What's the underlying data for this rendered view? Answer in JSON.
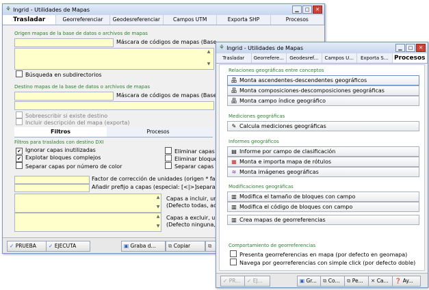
{
  "back": {
    "title": "Ingrid - Utilidades de Mapas",
    "tabs": [
      "Trasladar",
      "Georreferenciar",
      "Geodesreferenciar",
      "Campos UTM",
      "Exporta SHP",
      "Procesos"
    ],
    "origen_header": "Origen mapas de la base de datos o archivos de mapas",
    "mascara_label_1": "Máscara de códigos de mapas (Base",
    "busqueda": "Búsqueda en subdirectorios",
    "destino_header": "Destino mapas de la base de datos o archivos de mapas",
    "mascara_label_2": "Máscara de códigos de mapas (Base",
    "sobrescribir": "Sobreescribir si existe destino",
    "incluir": "Incluir descripción del mapa (exporta)",
    "subtabs": [
      "Filtros",
      "Procesos"
    ],
    "filtros_header": "Filtros para traslados con destino DXI",
    "ignorar": "Ignorar capas inutilizadas",
    "explotar": "Explotar bloques complejos",
    "separar": "Separar capas por número de color",
    "eliminar1": "Eliminar capas n",
    "eliminar2": "Eliminar bloque",
    "separar2": "Separar capas p",
    "factor": "Factor de corrección de unidades (origen * fa",
    "prefijo": "Añadir prefijo a capas (especial: [<|>]separa",
    "capas_incluir": "Capas a incluir, un",
    "capas_incluir_sub": "(Defecto todas, ad",
    "capas_excluir": "Capas a excluir, u",
    "capas_excluir_sub": "(Defecto ninguna,",
    "btn_prueba": "PRUEBA",
    "btn_ejecuta": "EJECUTA",
    "btn_graba": "Graba d...",
    "btn_copiar": "Copiar"
  },
  "front": {
    "title": "Ingrid - Utilidades de Mapas",
    "tabs": [
      "Trasladar",
      "Georrefere...",
      "Geodesref...",
      "Campos U...",
      "Exporta S...",
      "Procesos"
    ],
    "relaciones_header": "Relaciones geográficas entre conceptos",
    "btn_ascendentes": "Monta ascendentes-descendentes geográficos",
    "btn_composiciones": "Monta composiciones-descomposiciones geográficas",
    "btn_campo_indice": "Monta campo índice geográfico",
    "mediciones_header": "Mediciones geográficas",
    "btn_calcula": "Calcula mediciones geográficas",
    "informes_header": "Informes geográficos",
    "btn_informe": "Informe por campo de clasificación",
    "btn_rotulos": "Monta e importa mapa de rótulos",
    "btn_imagenes": "Monta imágenes geográficas",
    "modificaciones_header": "Modificaciones geográficas",
    "btn_tamano": "Modifica el tamaño de bloques con campo",
    "btn_codigo": "Modifica el código de bloques con campo",
    "btn_crea": "Crea mapas de georreferencias",
    "comportamiento_header": "Comportamiento de georreferencias",
    "presenta": "Presenta georreferencias en mapa (por defecto en geomapa)",
    "navega": "Navega por georreferencias con simple click (por defecto doble)",
    "btn_pr": "PR...",
    "btn_ej": "EJ...",
    "btn_gr": "Gr...",
    "btn_co": "Co...",
    "btn_pe": "Pe...",
    "btn_ca": "Ca...",
    "btn_ay": "Ay..."
  }
}
